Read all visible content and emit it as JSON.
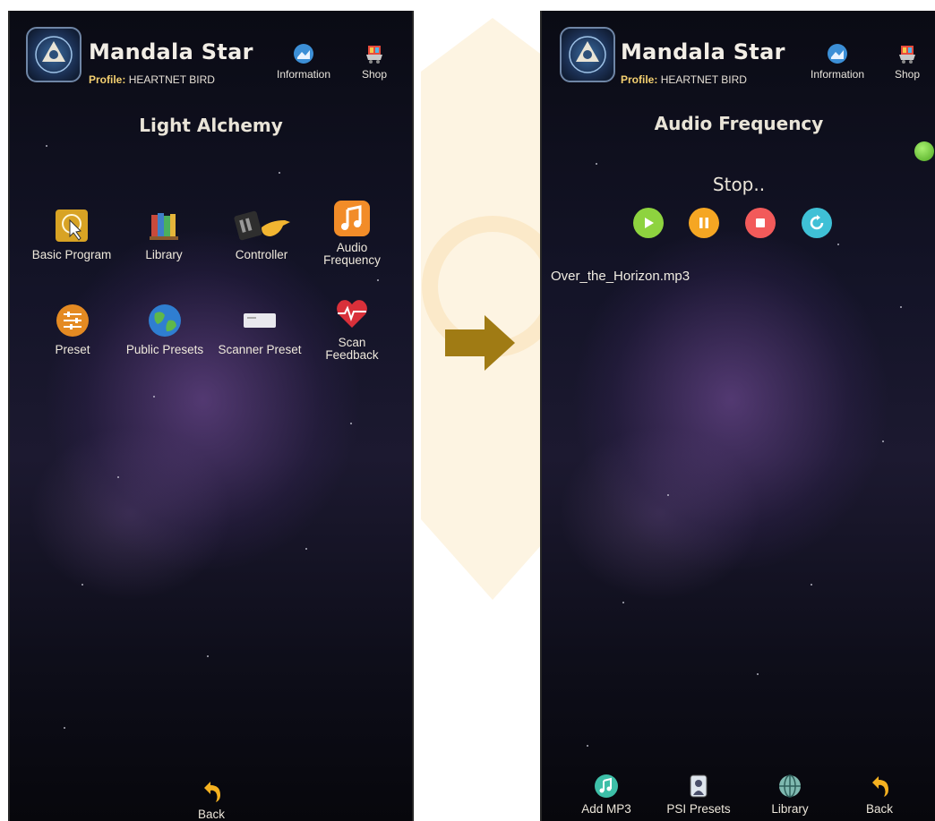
{
  "left_screen": {
    "app_title": "Mandala Star",
    "profile_label": "Profile:",
    "profile_name": "HEARTNET BIRD",
    "header_buttons": [
      {
        "label": "Information",
        "icon": "information-icon"
      },
      {
        "label": "Shop",
        "icon": "shop-cart-icon"
      }
    ],
    "screen_title": "Light Alchemy",
    "tiles": [
      {
        "label": "Basic Program",
        "icon": "basic-program-icon"
      },
      {
        "label": "Library",
        "icon": "library-books-icon"
      },
      {
        "label": "Controller",
        "icon": "controller-device-icon"
      },
      {
        "label_line1": "Audio",
        "label_line2": "Frequency",
        "icon": "audio-frequency-icon"
      },
      {
        "label": "Preset",
        "icon": "preset-sliders-icon"
      },
      {
        "label": "Public Presets",
        "icon": "globe-icon"
      },
      {
        "label": "Scanner Preset",
        "icon": "scanner-device-icon"
      },
      {
        "label_line1": "Scan",
        "label_line2": "Feedback",
        "icon": "heart-scan-icon"
      }
    ],
    "back_label": "Back"
  },
  "right_screen": {
    "app_title": "Mandala Star",
    "profile_label": "Profile:",
    "profile_name": "HEARTNET BIRD",
    "header_buttons": [
      {
        "label": "Information",
        "icon": "information-icon"
      },
      {
        "label": "Shop",
        "icon": "shop-cart-icon"
      }
    ],
    "screen_title": "Audio Frequency",
    "status_text": "Stop..",
    "controls": [
      {
        "name": "play",
        "icon": "play-icon",
        "color": "#8ed33f"
      },
      {
        "name": "pause",
        "icon": "pause-icon",
        "color": "#f5a623"
      },
      {
        "name": "stop",
        "icon": "stop-icon",
        "color": "#f25a5a"
      },
      {
        "name": "repeat",
        "icon": "repeat-icon",
        "color": "#3fc0d6"
      }
    ],
    "file_name": "Over_the_Horizon.mp3",
    "bottom_nav": [
      {
        "label": "Add MP3",
        "icon": "add-mp3-icon"
      },
      {
        "label": "PSI Presets",
        "icon": "psi-presets-icon"
      },
      {
        "label": "Library",
        "icon": "library-globe-icon"
      },
      {
        "label": "Back",
        "icon": "back-arrow-icon"
      }
    ]
  },
  "colors": {
    "arrow": "#a07b14",
    "accent_gold": "#f4d070",
    "background": "#10101e"
  }
}
